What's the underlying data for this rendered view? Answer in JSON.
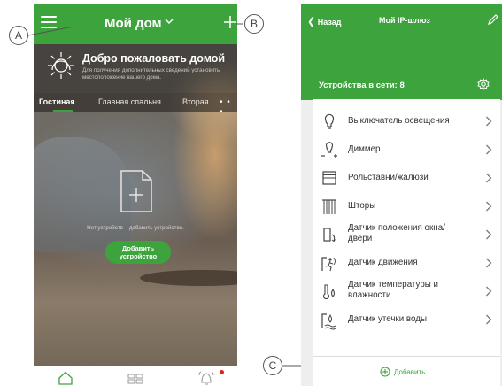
{
  "left_screen": {
    "header": {
      "title": "Мой дом"
    },
    "welcome": {
      "title": "Добро пожаловать домой",
      "subtitle": "Для получения дополнительных сведений установить местоположение вашего дома."
    },
    "room_tabs": [
      "Гостиная",
      "Главная спальня",
      "Вторая"
    ],
    "more_tabs": "• • •",
    "empty_state": {
      "text": "Нет устройств – добавить устройство.",
      "add_button": "Добавить\nустройство"
    }
  },
  "callouts": {
    "a": "A",
    "b": "B",
    "c": "C"
  },
  "right_screen": {
    "header": {
      "back_label": "Назад",
      "title": "Мой IP-шлюз"
    },
    "devices_count": "Устройства в сети: 8",
    "devices": [
      {
        "label": "Выключатель освещения",
        "icon": "bulb-icon"
      },
      {
        "label": "Диммер",
        "icon": "dimmer-icon"
      },
      {
        "label": "Рольставни/жалюзи",
        "icon": "shutter-icon"
      },
      {
        "label": "Шторы",
        "icon": "curtain-icon"
      },
      {
        "label": "Датчик положения окна/ двери",
        "icon": "window-sensor-icon"
      },
      {
        "label": "Датчик движения",
        "icon": "motion-sensor-icon"
      },
      {
        "label": "Датчик температуры и влажности",
        "icon": "temp-humidity-icon"
      },
      {
        "label": "Датчик утечки воды",
        "icon": "water-leak-icon"
      }
    ],
    "add_label": "Добавить"
  },
  "colors": {
    "accent": "#3da33d",
    "alert_dot": "#e2231a"
  }
}
